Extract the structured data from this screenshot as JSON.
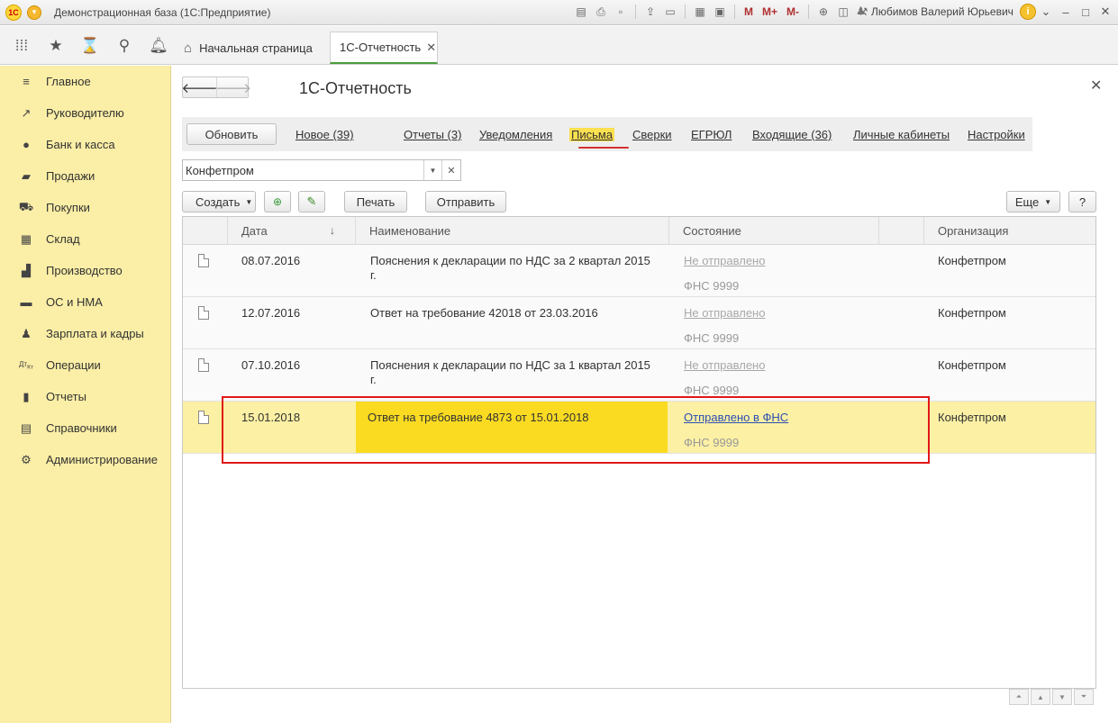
{
  "window": {
    "app_title": "Демонстрационная база  (1С:Предприятие)",
    "user": "Любимов Валерий Юрьевич",
    "toolbar_m": [
      "M",
      "M+",
      "M-"
    ]
  },
  "tabs": {
    "home": "Начальная страница",
    "active": "1С-Отчетность"
  },
  "sidebar": {
    "items": [
      {
        "label": "Главное",
        "icon": "menu-icon"
      },
      {
        "label": "Руководителю",
        "icon": "trend-icon"
      },
      {
        "label": "Банк и касса",
        "icon": "coin-icon"
      },
      {
        "label": "Продажи",
        "icon": "bag-icon"
      },
      {
        "label": "Покупки",
        "icon": "cart-icon"
      },
      {
        "label": "Склад",
        "icon": "grid-icon"
      },
      {
        "label": "Производство",
        "icon": "factory-icon"
      },
      {
        "label": "ОС и НМА",
        "icon": "truck-icon"
      },
      {
        "label": "Зарплата и кадры",
        "icon": "person-icon"
      },
      {
        "label": "Операции",
        "icon": "dt-kt-icon"
      },
      {
        "label": "Отчеты",
        "icon": "bar-chart-icon"
      },
      {
        "label": "Справочники",
        "icon": "book-icon"
      },
      {
        "label": "Администрирование",
        "icon": "gear-icon"
      }
    ]
  },
  "main": {
    "title": "1С-Отчетность",
    "refresh": "Обновить",
    "links": [
      "Новое (39)",
      "Отчеты (3)",
      "Уведомления",
      "Письма",
      "Сверки",
      "ЕГРЮЛ",
      "Входящие (36)",
      "Личные кабинеты",
      "Настройки"
    ],
    "active_link": "Письма",
    "org_filter": "Конфетпром",
    "actions": {
      "create": "Создать",
      "print": "Печать",
      "send": "Отправить",
      "more": "Еще",
      "help": "?"
    }
  },
  "table": {
    "columns": [
      "Дата",
      "Наименование",
      "Состояние",
      "Организация"
    ],
    "rows": [
      {
        "date": "08.07.2016",
        "name1": "Пояснения к декларации по НДС за 2 квартал 2015",
        "name2": "г.",
        "status": "Не отправлено",
        "recipient": "ФНС 9999",
        "org": "Конфетпром"
      },
      {
        "date": "12.07.2016",
        "name1": "Ответ на требование 42018 от 23.03.2016",
        "name2": "",
        "status": "Не отправлено",
        "recipient": "ФНС 9999",
        "org": "Конфетпром"
      },
      {
        "date": "07.10.2016",
        "name1": "Пояснения к декларации по НДС за 1 квартал 2015",
        "name2": "г.",
        "status": "Не отправлено",
        "recipient": "ФНС 9999",
        "org": "Конфетпром"
      },
      {
        "date": "15.01.2018",
        "name1": "Ответ на требование 4873 от 15.01.2018",
        "name2": "",
        "status": "Отправлено в ФНС",
        "recipient": "ФНС 9999",
        "org": "Конфетпром"
      }
    ]
  },
  "colors": {
    "sidebar_bg": "#fbeea6",
    "selected_row": "#fbf0a4",
    "current_cell": "#fadb22",
    "highlight_frame": "#e01818",
    "active_tab_underline": "#4a9e3c"
  }
}
